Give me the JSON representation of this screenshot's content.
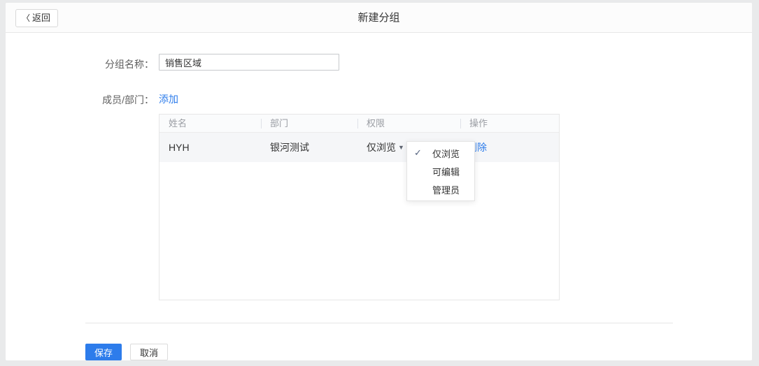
{
  "page": {
    "title": "新建分组"
  },
  "topbar": {
    "back_label": "返回"
  },
  "icons": {
    "back_chevron": "〈",
    "dropdown_arrow": "▼",
    "check": "✓"
  },
  "form": {
    "group_name_label": "分组名称：",
    "group_name_value": "销售区域",
    "members_label": "成员/部门：",
    "add_link_label": "添加"
  },
  "table": {
    "columns": [
      "姓名",
      "部门",
      "权限",
      "操作"
    ],
    "rows": [
      {
        "name": "HYH",
        "department": "银河测试",
        "permission": "仅浏览",
        "action": "删除"
      }
    ]
  },
  "dropdown": {
    "options": [
      {
        "label": "仅浏览",
        "selected": true
      },
      {
        "label": "可编辑",
        "selected": false
      },
      {
        "label": "管理员",
        "selected": false
      }
    ]
  },
  "footer": {
    "save_label": "保存",
    "cancel_label": "取消"
  },
  "colors": {
    "accent_blue": "#2d7ceb",
    "row_highlight": "#f5f6f8",
    "check_color": "#55627e",
    "page_background": "#e9eaeb"
  }
}
